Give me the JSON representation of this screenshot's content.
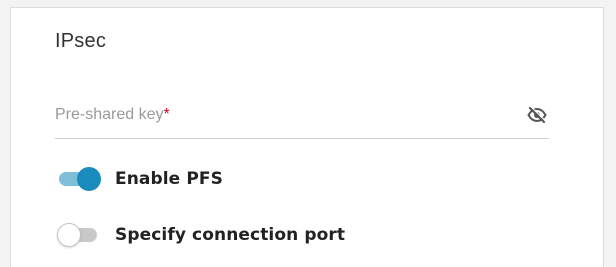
{
  "section": {
    "title": "IPsec"
  },
  "psk": {
    "label": "Pre-shared key",
    "required_mark": "*",
    "visibility_icon": "eye-slash-icon"
  },
  "toggles": [
    {
      "label": "Enable PFS",
      "state": "on"
    },
    {
      "label": "Specify connection port",
      "state": "off"
    }
  ],
  "colors": {
    "accent": "#1a8bbd",
    "accent_track": "#7fc0d8",
    "required": "#d0021b"
  }
}
